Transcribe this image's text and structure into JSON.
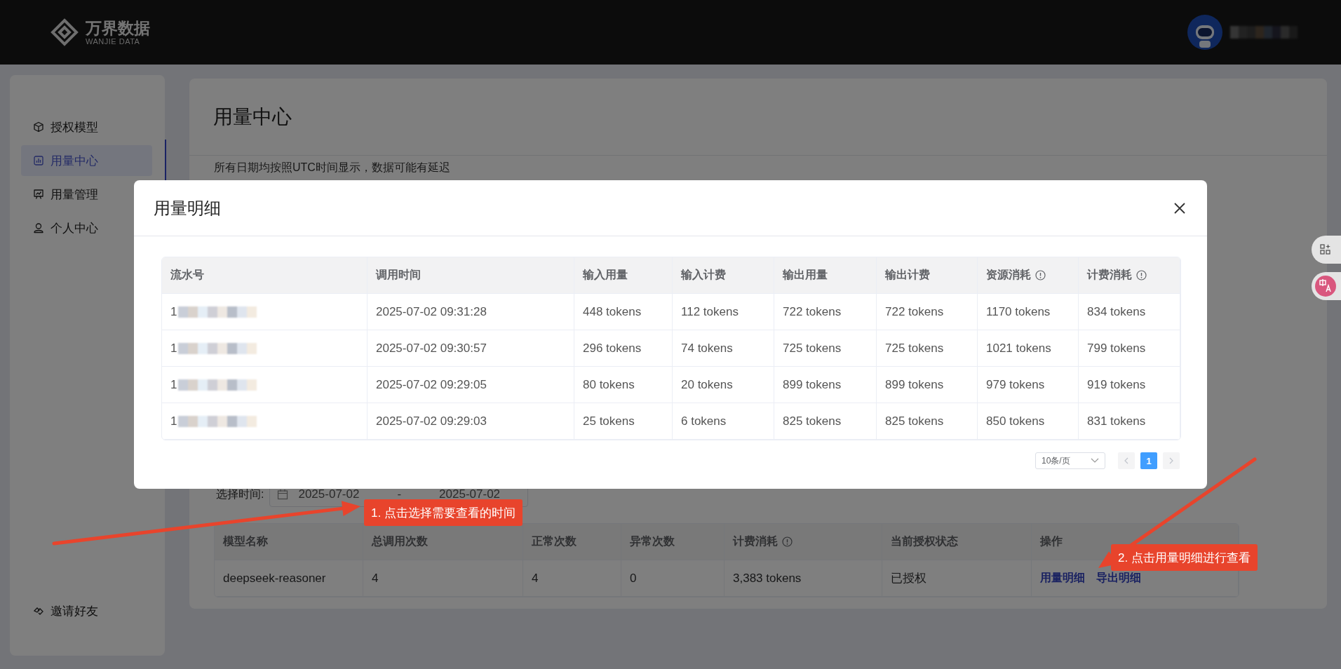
{
  "header": {
    "logo_title": "万界数据",
    "logo_subtitle": "WANJIE DATA"
  },
  "sidebar": {
    "items": [
      {
        "label": "授权模型",
        "selected": false
      },
      {
        "label": "用量中心",
        "selected": true
      },
      {
        "label": "用量管理",
        "selected": false
      },
      {
        "label": "个人中心",
        "selected": false
      }
    ],
    "footer_item": {
      "label": "邀请好友"
    }
  },
  "page": {
    "title": "用量中心",
    "notice": "所有日期均按照UTC时间显示，数据可能有延迟",
    "date_filter": {
      "label": "选择时间:",
      "start": "2025-07-02",
      "separator": "-",
      "end": "2025-07-02"
    },
    "table": {
      "columns": [
        {
          "label": "模型名称",
          "info": false
        },
        {
          "label": "总调用次数",
          "info": false
        },
        {
          "label": "正常次数",
          "info": false
        },
        {
          "label": "异常次数",
          "info": false
        },
        {
          "label": "计费消耗",
          "info": true
        },
        {
          "label": "当前授权状态",
          "info": false
        },
        {
          "label": "操作",
          "info": false
        }
      ],
      "rows": [
        {
          "cells": [
            "deepseek-reasoner",
            "4",
            "4",
            "0",
            "3,383 tokens",
            "已授权"
          ],
          "actions": [
            "用量明细",
            "导出明细"
          ]
        }
      ]
    }
  },
  "modal": {
    "title": "用量明细",
    "table": {
      "columns": [
        {
          "label": "流水号",
          "info": false,
          "kind": "redacted"
        },
        {
          "label": "调用时间",
          "info": false,
          "kind": "text"
        },
        {
          "label": "输入用量",
          "info": false,
          "kind": "text"
        },
        {
          "label": "输入计费",
          "info": false,
          "kind": "text"
        },
        {
          "label": "输出用量",
          "info": false,
          "kind": "text"
        },
        {
          "label": "输出计费",
          "info": false,
          "kind": "text"
        },
        {
          "label": "资源消耗",
          "info": true,
          "kind": "text"
        },
        {
          "label": "计费消耗",
          "info": true,
          "kind": "text"
        }
      ],
      "rows": [
        {
          "cells": [
            "1",
            "2025-07-02 09:31:28",
            "448 tokens",
            "112 tokens",
            "722 tokens",
            "722 tokens",
            "1170 tokens",
            "834 tokens"
          ]
        },
        {
          "cells": [
            "1",
            "2025-07-02 09:30:57",
            "296 tokens",
            "74 tokens",
            "725 tokens",
            "725 tokens",
            "1021 tokens",
            "799 tokens"
          ]
        },
        {
          "cells": [
            "1",
            "2025-07-02 09:29:05",
            "80 tokens",
            "20 tokens",
            "899 tokens",
            "899 tokens",
            "979 tokens",
            "919 tokens"
          ]
        },
        {
          "cells": [
            "1",
            "2025-07-02 09:29:03",
            "25 tokens",
            "6 tokens",
            "825 tokens",
            "825 tokens",
            "850 tokens",
            "831 tokens"
          ]
        }
      ]
    },
    "pagination": {
      "page_size": "10条/页",
      "pages": [
        {
          "label": "1",
          "selected": true
        }
      ]
    }
  },
  "annotations": [
    {
      "label": "1. 点击选择需要查看的时间"
    },
    {
      "label": "2. 点击用量明细进行查看"
    }
  ]
}
